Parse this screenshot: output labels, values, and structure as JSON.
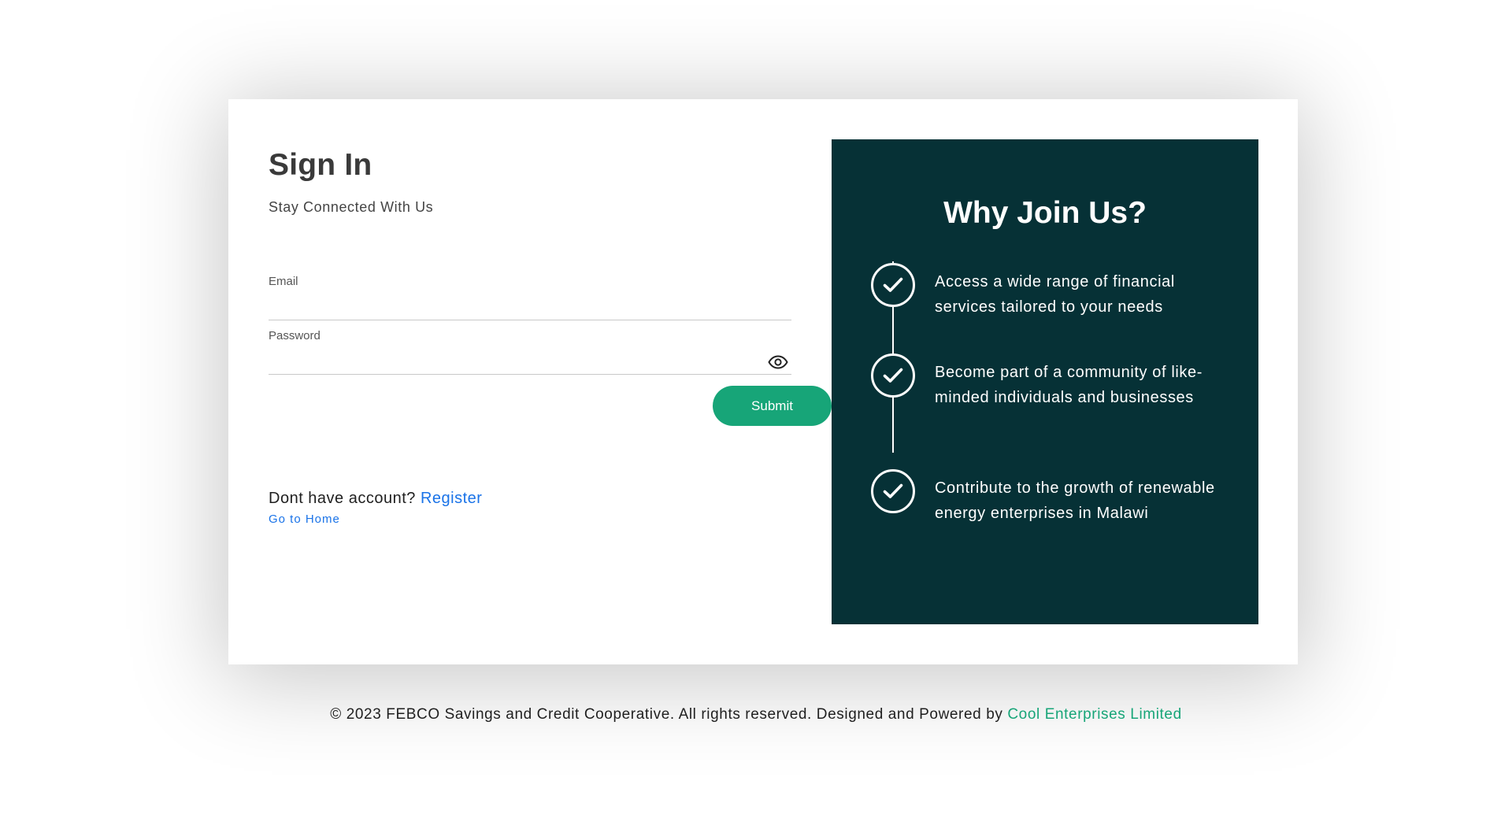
{
  "signin": {
    "title": "Sign In",
    "subtitle": "Stay Connected With Us",
    "email_label": "Email",
    "email_value": "",
    "password_label": "Password",
    "password_value": "",
    "submit_label": "Submit",
    "no_account_text": "Dont have account?",
    "register_link": "Register",
    "home_link": "Go to Home"
  },
  "why_join": {
    "title": "Why Join Us?",
    "benefits": [
      "Access a wide range of financial services tailored to your needs",
      "Become part of a community of like-minded individuals and businesses",
      "Contribute to the growth of renewable energy enterprises in Malawi"
    ],
    "icon": "check-circle-icon"
  },
  "footer": {
    "copyright": "© 2023 FEBCO Savings and Credit Cooperative. All rights reserved. Designed and Powered by",
    "company_link": "Cool Enterprises Limited"
  },
  "colors": {
    "accent": "#17a578",
    "panel_bg": "#063136",
    "link_blue": "#1a73e8"
  }
}
